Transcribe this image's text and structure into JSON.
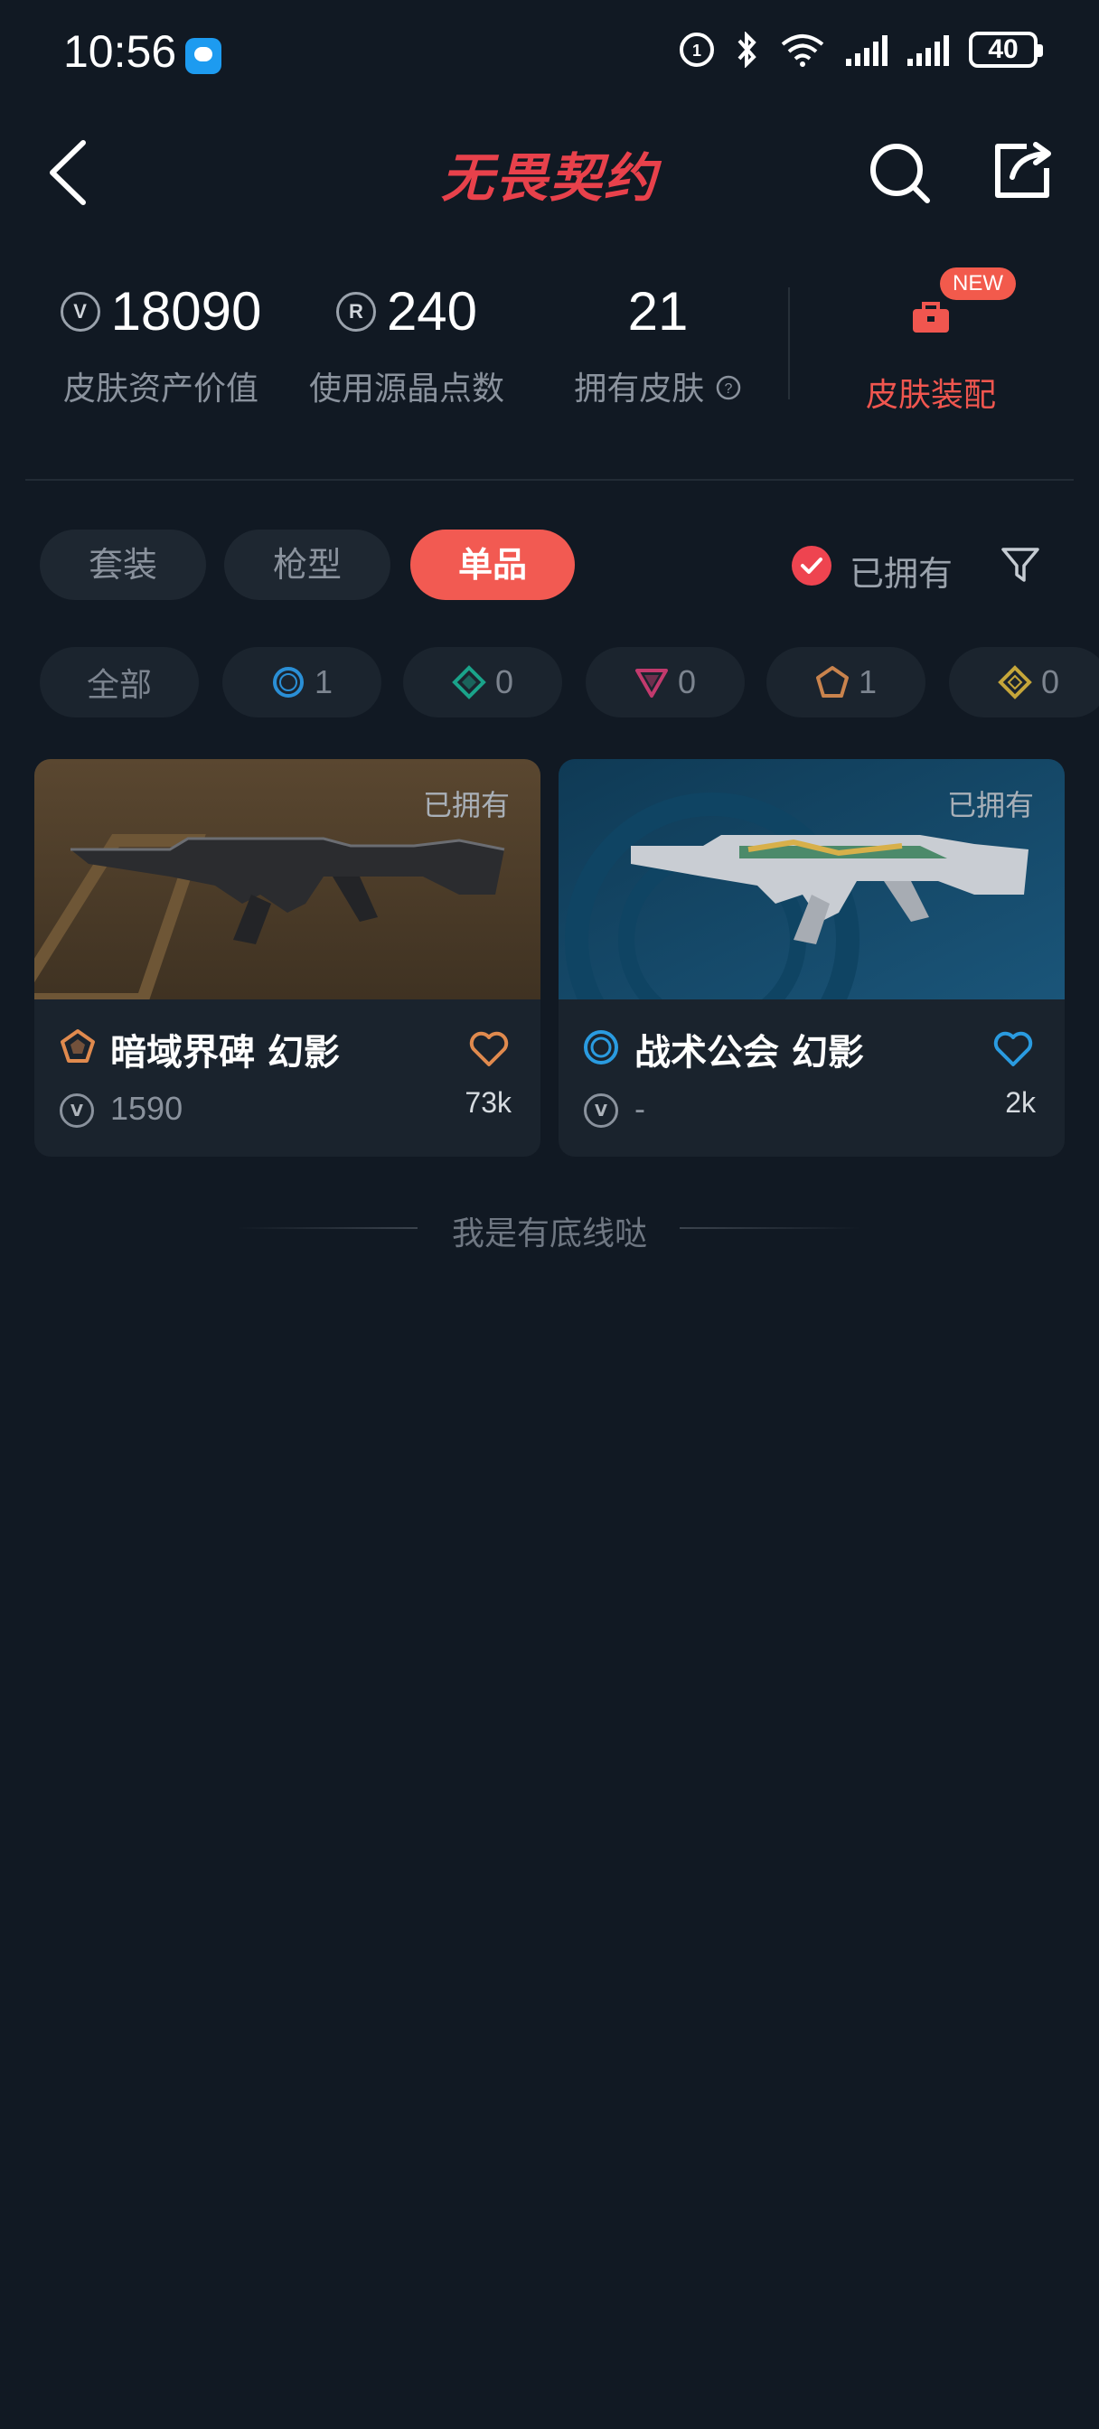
{
  "status_bar": {
    "time": "10:56",
    "battery": "40"
  },
  "header": {
    "title": "无畏契约"
  },
  "stats": [
    {
      "value": "18090",
      "label": "皮肤资产价值",
      "icon": "vp-coin-icon"
    },
    {
      "value": "240",
      "label": "使用源晶点数",
      "icon": "radianite-icon"
    },
    {
      "value": "21",
      "label": "拥有皮肤",
      "icon": "help-icon"
    }
  ],
  "equip": {
    "badge": "NEW",
    "label": "皮肤装配"
  },
  "tabs": [
    {
      "label": "套装",
      "active": false
    },
    {
      "label": "枪型",
      "active": false
    },
    {
      "label": "单品",
      "active": true
    }
  ],
  "filter": {
    "owned_label": "已拥有",
    "owned_checked": true
  },
  "rarity_chips": [
    {
      "label": "全部",
      "count": ""
    },
    {
      "label": "",
      "count": "1",
      "color": "#2a8fd6",
      "icon": "select-tier-icon"
    },
    {
      "label": "",
      "count": "0",
      "color": "#1aa38a",
      "icon": "deluxe-tier-icon"
    },
    {
      "label": "",
      "count": "0",
      "color": "#c23a6d",
      "icon": "premium-tier-icon"
    },
    {
      "label": "",
      "count": "1",
      "color": "#c9834d",
      "icon": "exclusive-tier-icon"
    },
    {
      "label": "",
      "count": "0",
      "color": "#c5a63a",
      "icon": "ultra-tier-icon"
    }
  ],
  "cards": [
    {
      "owned_tag": "已拥有",
      "name": "暗域界碑 幻影",
      "price": "1590",
      "likes": "73k",
      "tier_color": "#e08a4e",
      "heart_color": "#e08a4e"
    },
    {
      "owned_tag": "已拥有",
      "name": "战术公会 幻影",
      "price": "-",
      "likes": "2k",
      "tier_color": "#2a9be0",
      "heart_color": "#2a9be0"
    }
  ],
  "footer": {
    "text": "我是有底线哒"
  }
}
